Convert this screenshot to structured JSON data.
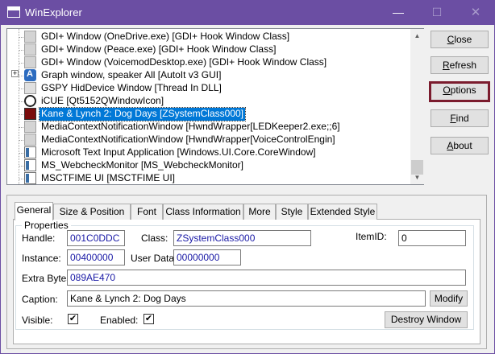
{
  "window": {
    "title": "WinExplorer",
    "minimize_glyph": "—",
    "maximize_glyph": "☐",
    "close_glyph": "✕"
  },
  "tree": {
    "rows": [
      {
        "label": "GDI+ Window (OneDrive.exe) [GDI+ Hook Window Class]",
        "icon": "window-icon",
        "selected": false
      },
      {
        "label": "GDI+ Window (Peace.exe) [GDI+ Hook Window Class]",
        "icon": "window-icon",
        "selected": false
      },
      {
        "label": "GDI+ Window (VoicemodDesktop.exe) [GDI+ Hook Window Class]",
        "icon": "window-icon",
        "selected": false
      },
      {
        "label": "Graph window, speaker All [AutoIt v3 GUI]",
        "icon": "autoit-icon",
        "selected": false,
        "expandable": true
      },
      {
        "label": "GSPY HidDevice Window [Thread In DLL]",
        "icon": "window-icon",
        "selected": false
      },
      {
        "label": "iCUE [Qt5152QWindowIcon]",
        "icon": "icue-icon",
        "selected": false
      },
      {
        "label": "Kane & Lynch 2: Dog Days [ZSystemClass000]",
        "icon": "game-icon",
        "selected": true
      },
      {
        "label": "MediaContextNotificationWindow [HwndWrapper[LEDKeeper2.exe;;6]",
        "icon": "window-icon",
        "selected": false
      },
      {
        "label": "MediaContextNotificationWindow [HwndWrapper[VoiceControlEngin]",
        "icon": "window-icon",
        "selected": false
      },
      {
        "label": "Microsoft Text Input Application [Windows.UI.Core.CoreWindow]",
        "icon": "app-icon",
        "selected": false
      },
      {
        "label": "MS_WebcheckMonitor [MS_WebcheckMonitor]",
        "icon": "app-icon",
        "selected": false
      },
      {
        "label": "MSCTFIME UI [MSCTFIME UI]",
        "icon": "app-icon",
        "selected": false
      }
    ],
    "expander_glyph": "+"
  },
  "buttons": {
    "close": {
      "pre": "",
      "u": "C",
      "post": "lose"
    },
    "refresh": {
      "pre": "",
      "u": "R",
      "post": "efresh"
    },
    "options": {
      "pre": "",
      "u": "O",
      "post": "ptions"
    },
    "find": {
      "pre": "",
      "u": "F",
      "post": "ind"
    },
    "about": {
      "pre": "",
      "u": "A",
      "post": "bout"
    }
  },
  "tabs": [
    "General",
    "Size & Position",
    "Font",
    "Class Information",
    "More",
    "Style",
    "Extended Style"
  ],
  "properties": {
    "legend": "Properties",
    "handle_label": "Handle:",
    "handle": "001C0DDC",
    "class_label": "Class:",
    "class": "ZSystemClass000",
    "itemid_label": "ItemID:",
    "itemid": "0",
    "instance_label": "Instance:",
    "instance": "00400000",
    "userdata_label": "User Data:",
    "userdata": "00000000",
    "extrabytes_label": "Extra Bytes:",
    "extrabytes": "089AE470",
    "caption_label": "Caption:",
    "caption": "Kane & Lynch 2: Dog Days",
    "modify_label": "Modify",
    "visible_label": "Visible:",
    "visible_check": "✔",
    "enabled_label": "Enabled:",
    "enabled_check": "✔",
    "destroy_label": "Destroy Window"
  },
  "scroll": {
    "up": "▲",
    "down": "▼"
  }
}
